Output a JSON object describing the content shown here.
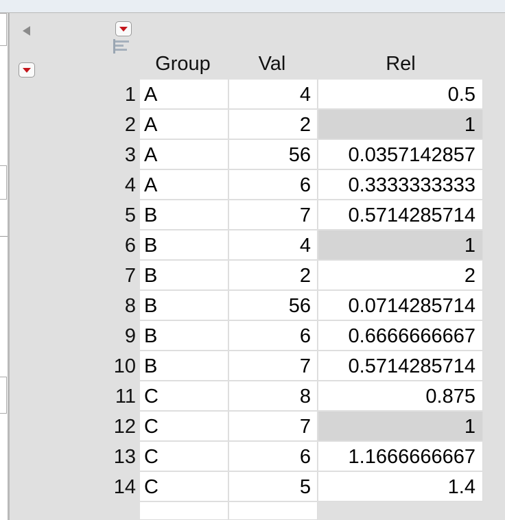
{
  "table": {
    "columns": [
      "Group",
      "Val",
      "Rel"
    ],
    "rows": [
      {
        "n": "1",
        "group": "A",
        "val": "4",
        "rel": "0.5",
        "selected": false
      },
      {
        "n": "2",
        "group": "A",
        "val": "2",
        "rel": "1",
        "selected": true
      },
      {
        "n": "3",
        "group": "A",
        "val": "56",
        "rel": "0.0357142857",
        "selected": false
      },
      {
        "n": "4",
        "group": "A",
        "val": "6",
        "rel": "0.3333333333",
        "selected": false
      },
      {
        "n": "5",
        "group": "B",
        "val": "7",
        "rel": "0.5714285714",
        "selected": false
      },
      {
        "n": "6",
        "group": "B",
        "val": "4",
        "rel": "1",
        "selected": true
      },
      {
        "n": "7",
        "group": "B",
        "val": "2",
        "rel": "2",
        "selected": false
      },
      {
        "n": "8",
        "group": "B",
        "val": "56",
        "rel": "0.0714285714",
        "selected": false
      },
      {
        "n": "9",
        "group": "B",
        "val": "6",
        "rel": "0.6666666667",
        "selected": false
      },
      {
        "n": "10",
        "group": "B",
        "val": "7",
        "rel": "0.5714285714",
        "selected": false
      },
      {
        "n": "11",
        "group": "C",
        "val": "8",
        "rel": "0.875",
        "selected": false
      },
      {
        "n": "12",
        "group": "C",
        "val": "7",
        "rel": "1",
        "selected": true
      },
      {
        "n": "13",
        "group": "C",
        "val": "6",
        "rel": "1.1666666667",
        "selected": false
      },
      {
        "n": "14",
        "group": "C",
        "val": "5",
        "rel": "1.4",
        "selected": false
      }
    ]
  },
  "icons": {
    "collapse": "triangle-left-icon",
    "table_menu": "red-triangle-menu-icon",
    "rows_menu": "red-triangle-menu-icon",
    "columns_panel": "columns-icon"
  },
  "colors": {
    "menu_triangle": "#c4161c",
    "selected_cell": "#d5d5d5",
    "header_panel": "#e0e0e0"
  }
}
